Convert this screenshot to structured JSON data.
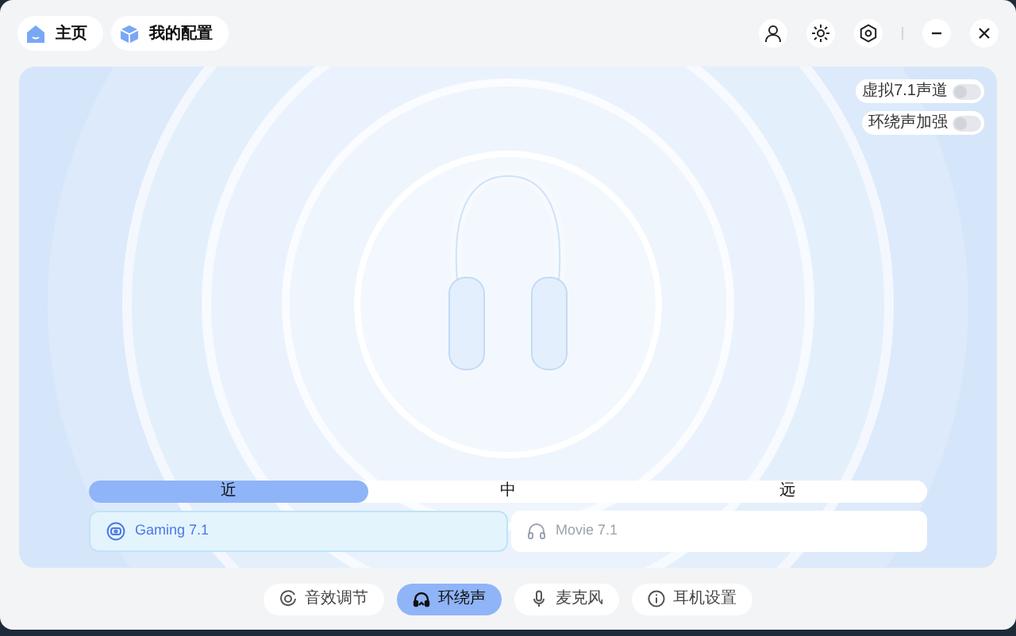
{
  "nav": [
    {
      "label": "主页",
      "kind": "home"
    },
    {
      "label": "我的配置",
      "kind": "box"
    }
  ],
  "toggles": [
    {
      "label": "虚拟7.1声道",
      "on": false
    },
    {
      "label": "环绕声加强",
      "on": false
    }
  ],
  "distance": [
    {
      "label": "近",
      "selected": true
    },
    {
      "label": "中",
      "selected": false
    },
    {
      "label": "远",
      "selected": false
    }
  ],
  "modes": [
    {
      "label": "Gaming 7.1",
      "kind": "gaming",
      "selected": true
    },
    {
      "label": "Movie 7.1",
      "kind": "movie",
      "selected": false
    }
  ],
  "tabs": [
    {
      "label": "音效调节",
      "kind": "eq",
      "selected": false
    },
    {
      "label": "环绕声",
      "kind": "surround",
      "selected": true
    },
    {
      "label": "麦克风",
      "kind": "mic",
      "selected": false
    },
    {
      "label": "耳机设置",
      "kind": "info",
      "selected": false
    }
  ]
}
